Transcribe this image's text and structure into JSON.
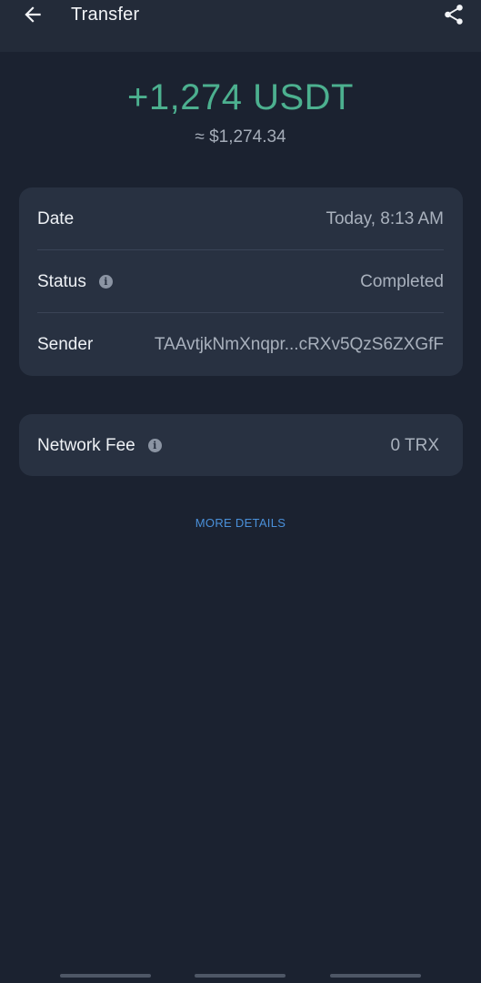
{
  "header": {
    "title": "Transfer"
  },
  "amount": {
    "primary": "+1,274 USDT",
    "fiat": "≈ $1,274.34"
  },
  "details": {
    "date_label": "Date",
    "date_value": "Today, 8:13 AM",
    "status_label": "Status",
    "status_value": "Completed",
    "sender_label": "Sender",
    "sender_value": "TAAvtjkNmXnqpr...cRXv5QzS6ZXGfF"
  },
  "fee": {
    "label": "Network Fee",
    "value": "0 TRX"
  },
  "more_details_label": "MORE DETAILS",
  "colors": {
    "accent_positive": "#4cb08f",
    "link": "#4a90d9",
    "background": "#1b2230",
    "card": "#283141"
  },
  "icons": {
    "back": "arrow-left-icon",
    "share": "share-icon",
    "info": "info-icon"
  }
}
